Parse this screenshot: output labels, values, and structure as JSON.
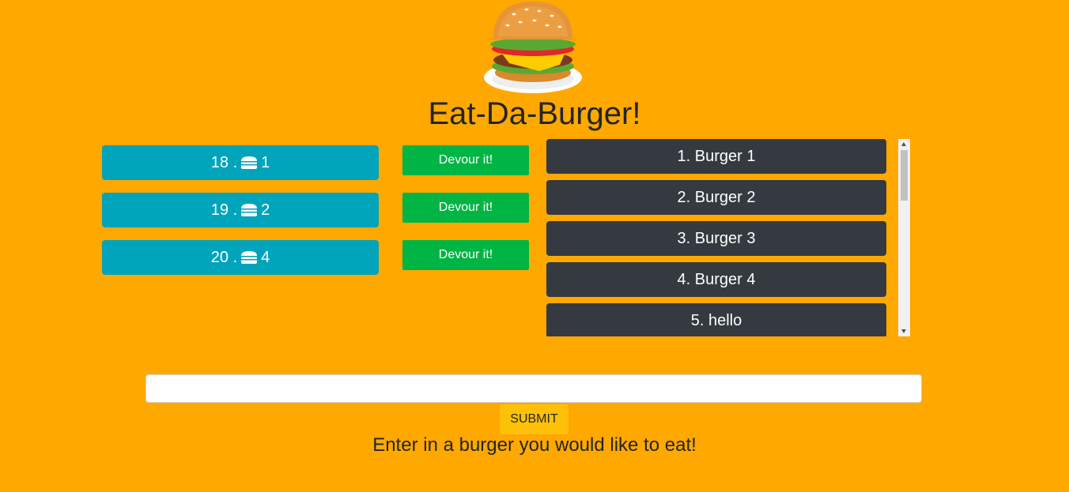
{
  "app": {
    "title": "Eat-Da-Burger!"
  },
  "uneaten": [
    {
      "id": "18",
      "sep": ".",
      "name": "1"
    },
    {
      "id": "19",
      "sep": ".",
      "name": "2"
    },
    {
      "id": "20",
      "sep": ".",
      "name": "4"
    }
  ],
  "devour_label": "Devour it!",
  "eaten": [
    {
      "label": "1. Burger 1"
    },
    {
      "label": "2. Burger 2"
    },
    {
      "label": "3. Burger 3"
    },
    {
      "label": "4. Burger 4"
    },
    {
      "label": "5. hello"
    }
  ],
  "form": {
    "input_value": "",
    "submit_label": "SUBMIT",
    "hint": "Enter in a burger you would like to eat!"
  },
  "colors": {
    "background": "#ffa800",
    "uneaten": "#00a4bb",
    "devour": "#00b543",
    "eaten": "#343a40",
    "submit": "#ffc107"
  },
  "icons": {
    "item_icon": "hamburger-icon",
    "logo": "burger-logo"
  }
}
